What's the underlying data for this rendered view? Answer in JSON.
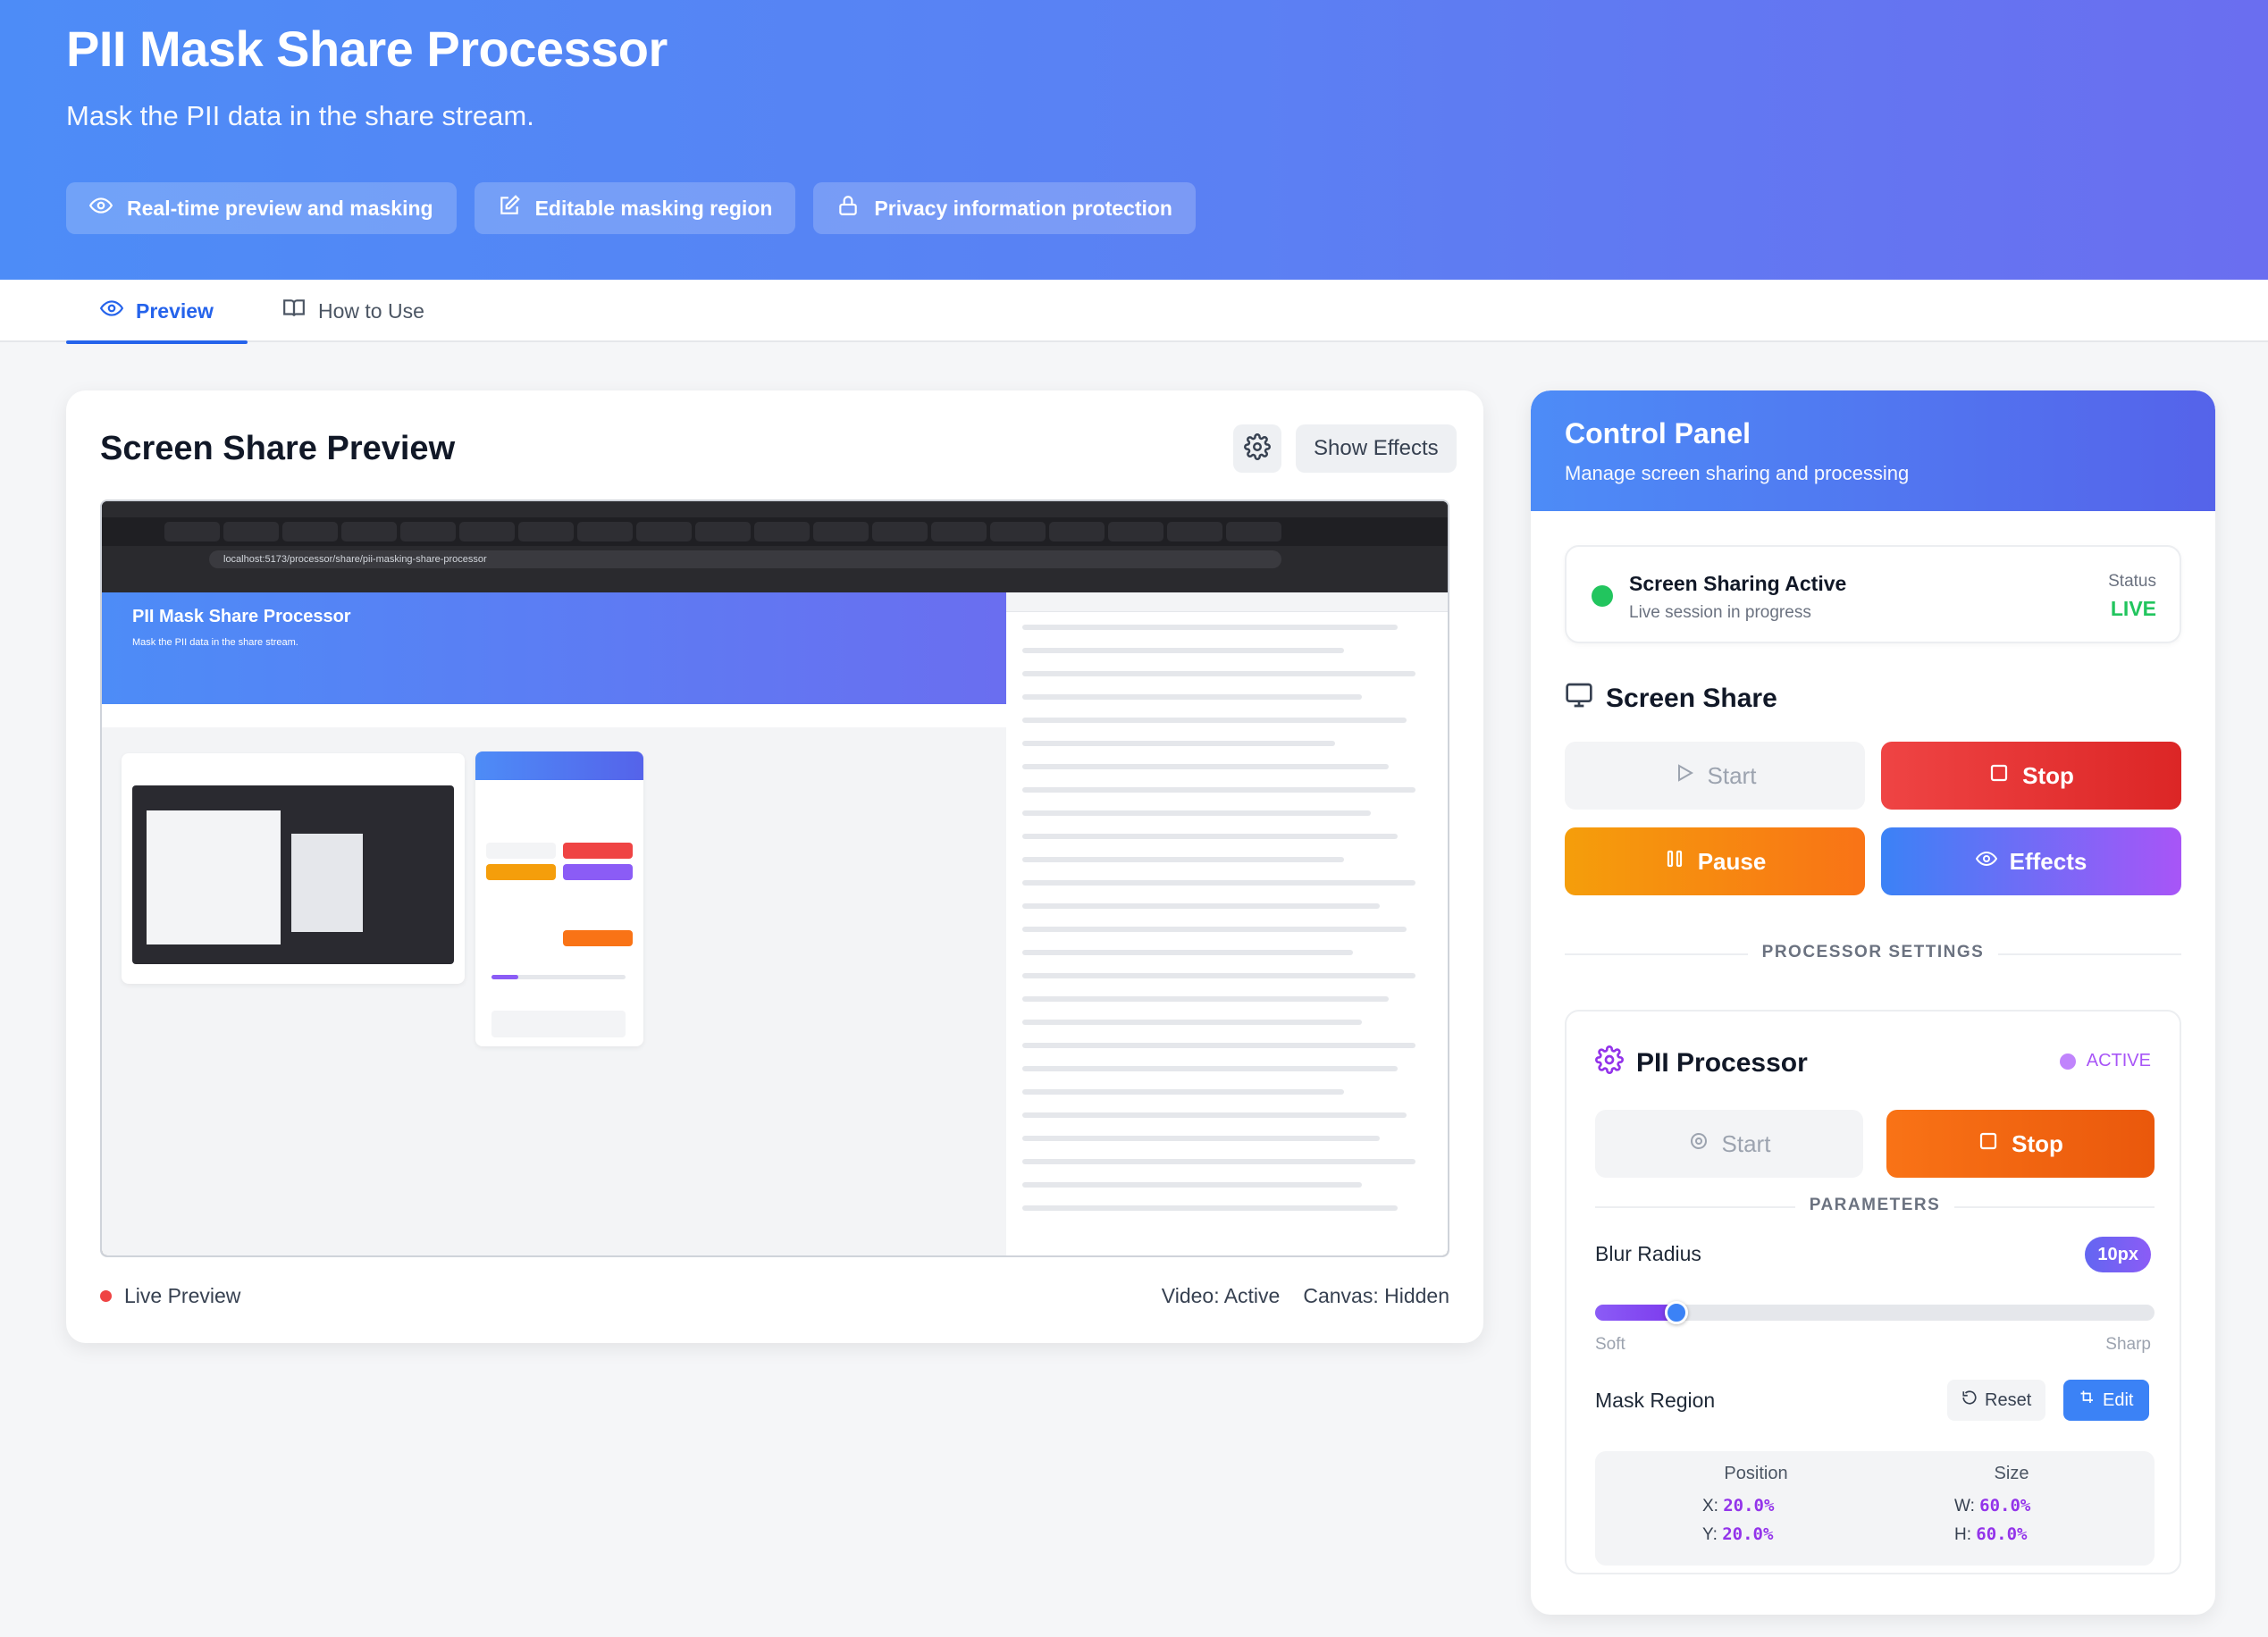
{
  "header": {
    "title": "PII Mask Share Processor",
    "subtitle": "Mask the PII data in the share stream.",
    "features": [
      {
        "label": "Real-time preview and masking",
        "icon": "eye-icon"
      },
      {
        "label": "Editable masking region",
        "icon": "edit-icon"
      },
      {
        "label": "Privacy information protection",
        "icon": "lock-icon"
      }
    ]
  },
  "tabs": [
    {
      "label": "Preview",
      "icon": "eye-icon",
      "active": true
    },
    {
      "label": "How to Use",
      "icon": "book-icon",
      "active": false
    }
  ],
  "preview": {
    "title": "Screen Share Preview",
    "show_effects_label": "Show Effects",
    "live_label": "Live Preview",
    "video_status": "Video: Active",
    "canvas_status": "Canvas: Hidden",
    "screen": {
      "address": "localhost:5173/processor/share/pii-masking-share-processor",
      "inner_title": "PII Mask Share Processor",
      "inner_subtitle": "Mask the PII data in the share stream."
    }
  },
  "control_panel": {
    "title": "Control Panel",
    "subtitle": "Manage screen sharing and processing",
    "status": {
      "title": "Screen Sharing Active",
      "subtitle": "Live session in progress",
      "status_label": "Status",
      "status_value": "LIVE"
    },
    "screen_share": {
      "title": "Screen Share",
      "start_label": "Start",
      "stop_label": "Stop",
      "pause_label": "Pause",
      "effects_label": "Effects"
    },
    "processor_settings_label": "PROCESSOR SETTINGS",
    "processor": {
      "title": "PII Processor",
      "state": "ACTIVE",
      "start_label": "Start",
      "stop_label": "Stop",
      "parameters_label": "PARAMETERS",
      "blur_radius_label": "Blur Radius",
      "blur_radius_value": "10px",
      "blur_slider_fraction": 0.13,
      "slider_min_label": "Soft",
      "slider_max_label": "Sharp",
      "mask_region_label": "Mask Region",
      "reset_label": "Reset",
      "edit_label": "Edit",
      "position_label": "Position",
      "size_label": "Size",
      "x_label": "X:",
      "x_value": "20.0%",
      "y_label": "Y:",
      "y_value": "20.0%",
      "w_label": "W:",
      "w_value": "60.0%",
      "h_label": "H:",
      "h_value": "60.0%"
    }
  },
  "colors": {
    "primary": "#3b82f6",
    "live": "#22c55e",
    "stop": "#ef4444",
    "pause": "#f59e0b",
    "accent_purple": "#a855f7"
  }
}
